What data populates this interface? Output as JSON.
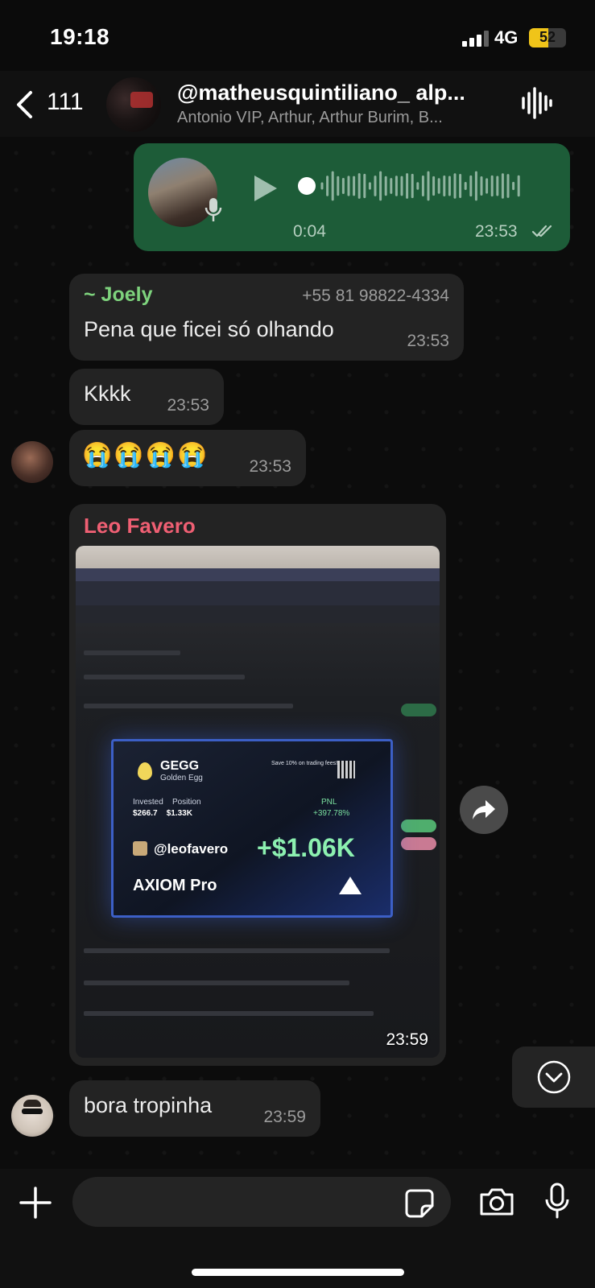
{
  "status": {
    "time": "19:18",
    "network": "4G",
    "battery": "52",
    "battery_level": 0.52
  },
  "header": {
    "back_count": "111",
    "title": "@matheusquintiliano_ alp...",
    "subtitle": "Antonio VIP, Arthur, Arthur Burim, B..."
  },
  "messages": {
    "voice": {
      "duration": "0:04",
      "time": "23:53"
    },
    "joely": {
      "sender": "~ Joely",
      "phone": "+55 81 98822-4334",
      "text": "Pena que ficei só olhando",
      "time": "23:53"
    },
    "kkkk": {
      "text": "Kkkk",
      "time": "23:53"
    },
    "emoji": {
      "text": "😭😭😭😭",
      "time": "23:53"
    },
    "leo": {
      "sender": "Leo Favero",
      "time": "23:59",
      "card": {
        "token": "GEGG",
        "token_name": "Golden Egg",
        "promo": "Save 10% on trading fees!",
        "invested_label": "Invested",
        "invested": "$266.7",
        "position_label": "Position",
        "position": "$1.33K",
        "pnl_label": "PNL",
        "pnl_pct": "+397.78%",
        "handle": "@leofavero",
        "pnl": "+$1.06K",
        "brand": "AXIOM Pro"
      }
    },
    "bora": {
      "text": "bora tropinha",
      "time": "23:59"
    }
  },
  "icons": {
    "back": "chevron-left-icon",
    "waveform": "waveform-icon",
    "forward": "forward-icon",
    "scroll": "chevron-down-circle-icon",
    "plus": "plus-icon",
    "sticker": "sticker-icon",
    "camera": "camera-icon",
    "mic": "microphone-icon"
  },
  "colors": {
    "outgoing": "#1d5c38",
    "incoming": "#232323",
    "joely": "#7ed37d",
    "leo": "#ef5f73"
  }
}
